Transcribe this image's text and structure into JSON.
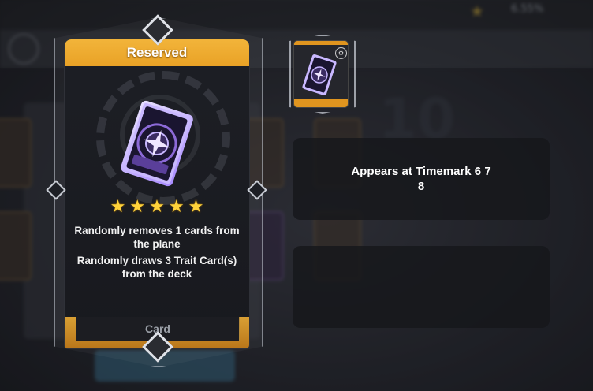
{
  "background": {
    "percent": "6.55%"
  },
  "card": {
    "header": "Reserved",
    "stars": 5,
    "description": [
      "Randomly removes 1 cards from the plane",
      "Randomly draws 3 Trait Card(s) from the deck"
    ],
    "footer": "Card",
    "header_color": "#e9a226"
  },
  "info": {
    "line1": "Appears at Timemark 6 7",
    "line2": "8"
  },
  "icons": [
    "star-icon",
    "card-art-icon",
    "thumbnail-card-icon",
    "gear-decoration-icon"
  ]
}
